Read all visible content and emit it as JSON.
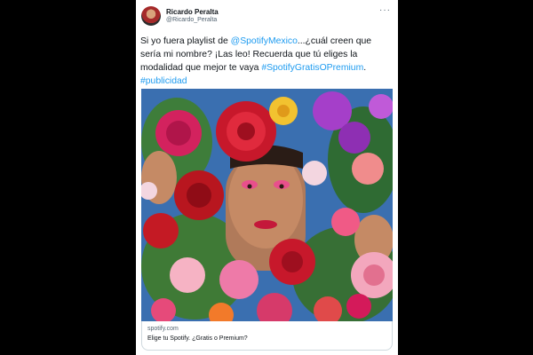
{
  "tweet": {
    "author_name": "Ricardo Peralta",
    "author_handle": "@Ricardo_Peralta",
    "more_icon": "···",
    "text_before": "Si yo fuera playlist de ",
    "mention": "@SpotifyMexico",
    "text_after": "...¿cuál creen que sería mi nombre? ¡Las leo! Recuerda que tú eliges la modalidad que mejor te vaya ",
    "hashtag1": "#SpotifyGratisOPremium",
    "separator": ". ",
    "hashtag2": "#publicidad"
  },
  "link_card": {
    "domain": "spotify.com",
    "title": "Elige tu Spotify. ¿Gratis o Premium?"
  },
  "colors": {
    "link": "#1d9bf0",
    "backdrop": "#3a6fb0",
    "page_background": "#000000"
  }
}
